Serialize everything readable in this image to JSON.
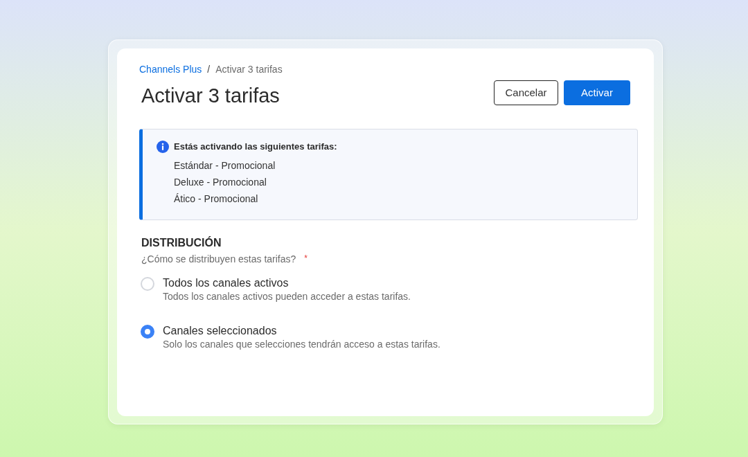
{
  "breadcrumb": {
    "items": [
      {
        "label": "Channels Plus",
        "kind": "link"
      },
      {
        "label": "Activar 3 tarifas",
        "kind": "current"
      }
    ],
    "separator": "/"
  },
  "title": "Activar 3 tarifas",
  "actions": [
    {
      "label": "Cancelar",
      "kind": "secondary"
    },
    {
      "label": "Activar",
      "kind": "primary"
    }
  ],
  "notice": {
    "heading": "Estás activando las siguientes tarifas:",
    "items": [
      "Estándar - Promocional",
      "Deluxe - Promocional",
      "Ático - Promocional"
    ]
  },
  "distribution": {
    "heading": "DISTRIBUCIÓN",
    "question": "¿Cómo se distribuyen estas tarifas?",
    "required_mark": "*",
    "options": [
      {
        "label": "Todos los canales activos",
        "description": "Todos los canales activos pueden acceder a estas tarifas.",
        "selected": false
      },
      {
        "label": "Canales seleccionados",
        "description": "Solo los canales que selecciones tendrán acceso a estas tarifas.",
        "selected": true
      }
    ]
  }
}
